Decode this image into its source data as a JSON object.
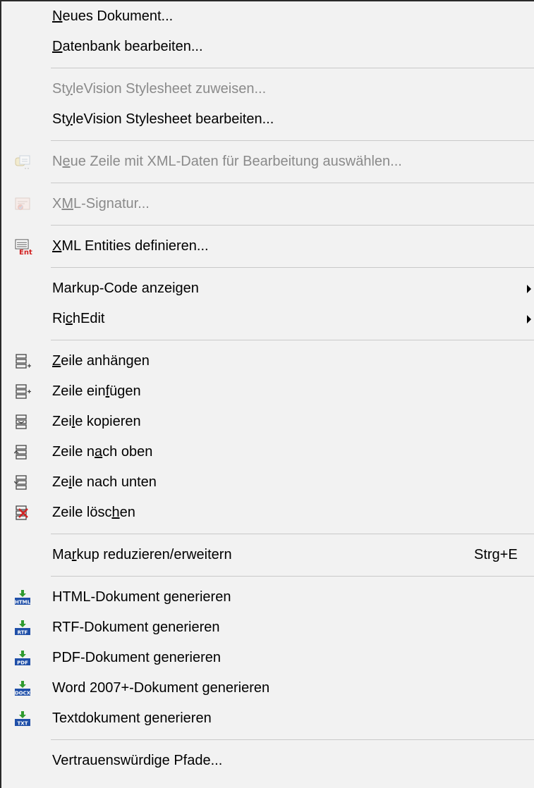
{
  "menu": {
    "items": [
      {
        "type": "item",
        "name": "menu-item-neues-dokument",
        "label": "Neues Dokument...",
        "u": 0,
        "icon": "",
        "disabled": false
      },
      {
        "type": "item",
        "name": "menu-item-datenbank-bearbeiten",
        "label": "Datenbank bearbeiten...",
        "u": 0,
        "icon": "",
        "disabled": false
      },
      {
        "type": "sep"
      },
      {
        "type": "item",
        "name": "menu-item-stylesheet-zuweisen",
        "label": "StyleVision Stylesheet zuweisen...",
        "u": 2,
        "icon": "",
        "disabled": true
      },
      {
        "type": "item",
        "name": "menu-item-stylesheet-bearbeiten",
        "label": "StyleVision Stylesheet bearbeiten...",
        "u": 2,
        "icon": "",
        "disabled": false
      },
      {
        "type": "sep"
      },
      {
        "type": "item",
        "name": "menu-item-neue-zeile-xml-daten",
        "label": "Neue Zeile mit XML-Daten für Bearbeitung auswählen...",
        "u": 1,
        "icon": "db-row-icon",
        "disabled": true
      },
      {
        "type": "sep"
      },
      {
        "type": "item",
        "name": "menu-item-xml-signatur",
        "label": "XML-Signatur...",
        "u": 1,
        "icon": "signature-icon",
        "disabled": true
      },
      {
        "type": "sep"
      },
      {
        "type": "item",
        "name": "menu-item-xml-entities",
        "label": "XML Entities definieren...",
        "u": 0,
        "icon": "entities-icon",
        "disabled": false
      },
      {
        "type": "sep"
      },
      {
        "type": "item",
        "name": "menu-item-markup-code-anzeigen",
        "label": "Markup-Code anzeigen",
        "u": -1,
        "icon": "",
        "disabled": false,
        "submenu": true
      },
      {
        "type": "item",
        "name": "menu-item-richedit",
        "label": "RichEdit",
        "u": 2,
        "icon": "",
        "disabled": false,
        "submenu": true
      },
      {
        "type": "sep"
      },
      {
        "type": "item",
        "name": "menu-item-zeile-anhaengen",
        "label": "Zeile anhängen",
        "u": 0,
        "icon": "row-append-icon",
        "disabled": false
      },
      {
        "type": "item",
        "name": "menu-item-zeile-einfuegen",
        "label": "Zeile einfügen",
        "u": 9,
        "icon": "row-insert-icon",
        "disabled": false
      },
      {
        "type": "item",
        "name": "menu-item-zeile-kopieren",
        "label": "Zeile kopieren",
        "u": 3,
        "icon": "row-copy-icon",
        "disabled": false
      },
      {
        "type": "item",
        "name": "menu-item-zeile-nach-oben",
        "label": "Zeile nach oben",
        "u": 7,
        "icon": "row-up-icon",
        "disabled": false
      },
      {
        "type": "item",
        "name": "menu-item-zeile-nach-unten",
        "label": "Zeile nach unten",
        "u": 2,
        "icon": "row-down-icon",
        "disabled": false
      },
      {
        "type": "item",
        "name": "menu-item-zeile-loeschen",
        "label": "Zeile löschen",
        "u": 10,
        "icon": "row-delete-icon",
        "disabled": false
      },
      {
        "type": "sep"
      },
      {
        "type": "item",
        "name": "menu-item-markup-reduzieren",
        "label": "Markup reduzieren/erweitern",
        "u": 2,
        "icon": "",
        "disabled": false,
        "shortcut": "Strg+E"
      },
      {
        "type": "sep"
      },
      {
        "type": "item",
        "name": "menu-item-html-generieren",
        "label": "HTML-Dokument generieren",
        "u": -1,
        "icon": "generate-html-icon",
        "disabled": false
      },
      {
        "type": "item",
        "name": "menu-item-rtf-generieren",
        "label": "RTF-Dokument generieren",
        "u": -1,
        "icon": "generate-rtf-icon",
        "disabled": false
      },
      {
        "type": "item",
        "name": "menu-item-pdf-generieren",
        "label": "PDF-Dokument generieren",
        "u": -1,
        "icon": "generate-pdf-icon",
        "disabled": false
      },
      {
        "type": "item",
        "name": "menu-item-word-generieren",
        "label": "Word 2007+-Dokument generieren",
        "u": -1,
        "icon": "generate-docx-icon",
        "disabled": false
      },
      {
        "type": "item",
        "name": "menu-item-text-generieren",
        "label": "Textdokument generieren",
        "u": -1,
        "icon": "generate-txt-icon",
        "disabled": false
      },
      {
        "type": "sep"
      },
      {
        "type": "item",
        "name": "menu-item-vertrauenswuerdige-pfade",
        "label": "Vertrauenswürdige Pfade...",
        "u": -1,
        "icon": "",
        "disabled": false
      }
    ],
    "badges": {
      "entities": "Ent",
      "html": "HTML",
      "rtf": "RTF",
      "pdf": "PDF",
      "docx": "DOCX",
      "txt": "TXT"
    },
    "colors": {
      "background": "#f2f2f2",
      "text": "#000000",
      "disabled_text": "#8a8a8a",
      "separator": "#c9c9c9",
      "badge_blue": "#1f4fa8",
      "arrow_green": "#2f9a2f",
      "delete_red": "#d22222"
    }
  }
}
